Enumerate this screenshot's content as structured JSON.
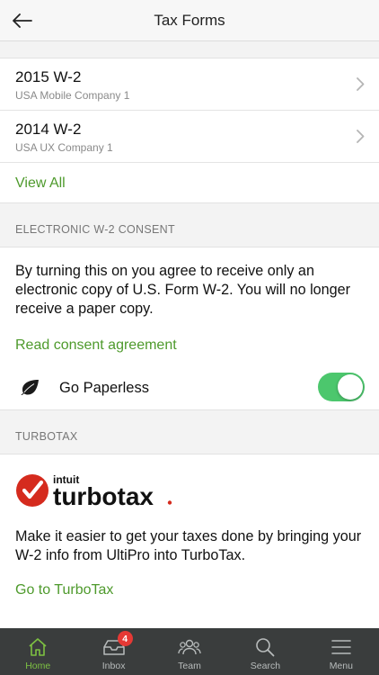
{
  "header": {
    "title": "Tax Forms",
    "back_icon": "arrow-left-icon"
  },
  "tax_forms": {
    "items": [
      {
        "title": "2015 W-2",
        "company": "USA Mobile Company 1"
      },
      {
        "title": "2014 W-2",
        "company": "USA UX Company 1"
      }
    ],
    "view_all": "View All"
  },
  "consent": {
    "section_label": "ELECTRONIC W-2 CONSENT",
    "text": "By turning this on you agree to receive only an electronic copy of U.S. Form W-2. You will no longer receive a paper copy.",
    "link": "Read consent agreement",
    "paperless_label": "Go Paperless",
    "paperless_on": true
  },
  "turbotax": {
    "section_label": "TURBOTAX",
    "logo_small": "intuit",
    "logo_big": "turbotax",
    "text": "Make it easier to get your taxes done by bringing your W-2 info from UltiPro into TurboTax.",
    "link": "Go to TurboTax"
  },
  "tabbar": {
    "tabs": [
      {
        "label": "Home",
        "icon": "home-icon",
        "active": true
      },
      {
        "label": "Inbox",
        "icon": "inbox-icon",
        "badge": "4"
      },
      {
        "label": "Team",
        "icon": "team-icon"
      },
      {
        "label": "Search",
        "icon": "search-icon"
      },
      {
        "label": "Menu",
        "icon": "menu-icon"
      }
    ]
  },
  "colors": {
    "accent_green": "#4e9a2c",
    "toggle_on": "#4cc76d",
    "tabbar_bg": "#3a3d3d",
    "badge_red": "#e53935",
    "turbotax_red": "#d52b1e"
  }
}
